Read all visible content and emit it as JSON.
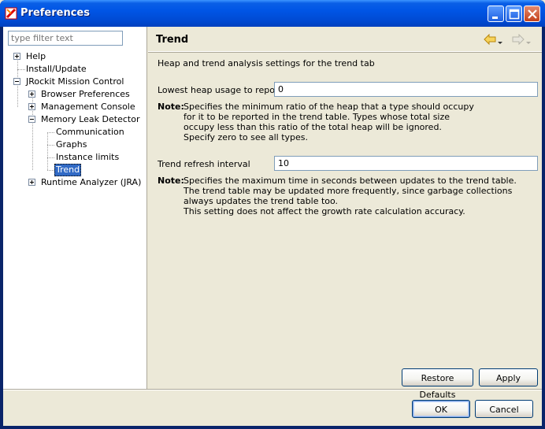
{
  "window": {
    "title": "Preferences",
    "icon": "preferences-app-icon",
    "controls": [
      "minimize-icon",
      "maximize-icon",
      "close-icon"
    ]
  },
  "sidebar": {
    "filter_placeholder": "type filter text",
    "tree": [
      {
        "label": "Help",
        "level": 0,
        "expander": "plus"
      },
      {
        "label": "Install/Update",
        "level": 0,
        "expander": "none"
      },
      {
        "label": "JRockit Mission Control",
        "level": 0,
        "expander": "minus"
      },
      {
        "label": "Browser Preferences",
        "level": 1,
        "expander": "plus"
      },
      {
        "label": "Management Console",
        "level": 1,
        "expander": "plus"
      },
      {
        "label": "Memory Leak Detector",
        "level": 1,
        "expander": "minus"
      },
      {
        "label": "Communication",
        "level": 2,
        "expander": "none"
      },
      {
        "label": "Graphs",
        "level": 2,
        "expander": "none"
      },
      {
        "label": "Instance limits",
        "level": 2,
        "expander": "none"
      },
      {
        "label": "Trend",
        "level": 2,
        "expander": "none",
        "selected": true
      },
      {
        "label": "Runtime Analyzer (JRA)",
        "level": 1,
        "expander": "plus"
      }
    ]
  },
  "page": {
    "title": "Trend",
    "description": "Heap and trend analysis settings for the trend tab",
    "nav": {
      "back": "back-arrow-icon",
      "forward": "forward-arrow-icon"
    },
    "fields": [
      {
        "label": "Lowest heap usage to report",
        "value": "0",
        "note_label": "Note:",
        "note_lines": [
          "Specifies the minimum ratio of the heap that a type should occupy",
          "for it to be reported in the trend table. Types whose total size",
          "occupy less than this ratio of the total heap will be ignored.",
          "Specify zero to see all types."
        ]
      },
      {
        "label": "Trend refresh interval",
        "value": "10",
        "note_label": "Note:",
        "note_lines": [
          "Specifies the maximum time in seconds between updates to the trend table.",
          "The trend table may be updated more frequently, since garbage collections",
          "always updates the trend table too.",
          "This setting does not affect the growth rate calculation accuracy."
        ]
      }
    ],
    "restore_defaults_label": "Restore Defaults",
    "apply_label": "Apply"
  },
  "footer": {
    "ok_label": "OK",
    "cancel_label": "Cancel"
  },
  "colors": {
    "titlebar": "#0055e5",
    "selection": "#316ac5",
    "dialog_bg": "#ece9d8"
  }
}
